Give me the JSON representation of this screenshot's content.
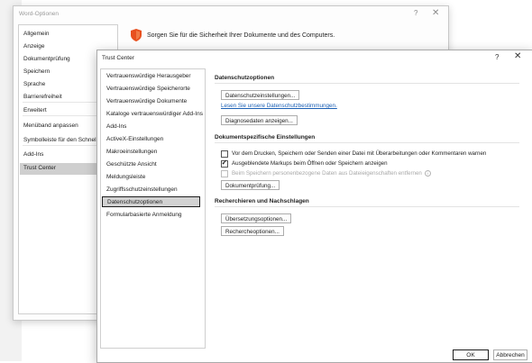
{
  "word_options": {
    "title": "Word-Optionen",
    "help_glyph": "?",
    "close_glyph": "✕",
    "banner": "Sorgen Sie für die Sicherheit Ihrer Dokumente und des Computers.",
    "nav": [
      "Allgemein",
      "Anzeige",
      "Dokumentprüfung",
      "Speichern",
      "Sprache",
      "Barrierefreiheit",
      "Erweitert",
      "Menüband anpassen",
      "Symbolleiste für den Schnellzu",
      "Add-Ins",
      "Trust Center"
    ],
    "selected_nav": "Trust Center"
  },
  "trust_center": {
    "title": "Trust Center",
    "help_glyph": "?",
    "close_glyph": "✕",
    "nav": [
      "Vertrauenswürdige Herausgeber",
      "Vertrauenswürdige Speicherorte",
      "Vertrauenswürdige Dokumente",
      "Kataloge vertrauenswürdiger Add-Ins",
      "Add-Ins",
      "ActiveX-Einstellungen",
      "Makroeinstellungen",
      "Geschützte Ansicht",
      "Meldungsleiste",
      "Zugriffsschutzeinstellungen",
      "Datenschutzoptionen",
      "Formularbasierte Anmeldung"
    ],
    "selected_nav": "Datenschutzoptionen",
    "privacy": {
      "heading": "Datenschutzoptionen",
      "settings_button": "Datenschutzeinstellungen...",
      "statement_link": "Lesen Sie unsere Datenschutzbestimmungen.",
      "diagnostics_button": "Diagnosedaten anzeigen..."
    },
    "doc_settings": {
      "heading": "Dokumentspezifische Einstellungen",
      "checkboxes": [
        {
          "label": "Vor dem Drucken, Speichern oder Senden einer Datei mit Überarbeitungen oder Kommentaren warnen",
          "checked": false,
          "disabled": false
        },
        {
          "label": "Ausgeblendete Markups beim Öffnen oder Speichern anzeigen",
          "checked": true,
          "disabled": false
        },
        {
          "label": "Beim Speichern personenbezogene Daten aus Dateieigenschaften entfernen",
          "checked": false,
          "disabled": true
        }
      ],
      "inspect_button": "Dokumentprüfung..."
    },
    "research": {
      "heading": "Recherchieren und Nachschlagen",
      "translation_button": "Übersetzungsoptionen...",
      "research_button": "Rechercheoptionen..."
    },
    "footer": {
      "ok": "OK",
      "cancel": "Abbrechen"
    }
  },
  "colors": {
    "shield": "#e8501e",
    "link": "#1a5fb4",
    "selection": "#d2d2d2"
  }
}
